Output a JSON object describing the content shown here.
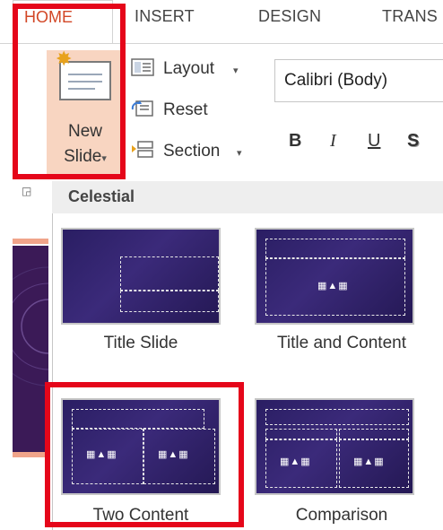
{
  "tabs": [
    {
      "label": "HOME",
      "active": true
    },
    {
      "label": "INSERT"
    },
    {
      "label": "DESIGN"
    },
    {
      "label": "TRANS"
    }
  ],
  "ribbon": {
    "new_slide_line1": "New",
    "new_slide_line2": "Slide",
    "new_slide_caret": "▾",
    "layout_label": "Layout",
    "reset_label": "Reset",
    "section_label": "Section",
    "caret": "▾",
    "font_name": "Calibri (Body)",
    "bold": "B",
    "italic": "I",
    "underline": "U",
    "shadow": "S"
  },
  "gallery": {
    "header": "Celestial",
    "layouts": [
      {
        "label": "Title Slide"
      },
      {
        "label": "Title and Content"
      },
      {
        "label": "Two Content"
      },
      {
        "label": "Comparison"
      }
    ]
  },
  "colors": {
    "accent": "#d24726",
    "highlight": "#e5061a",
    "new_slide_bg": "#f8d5c1",
    "theme_bg": "#2a1e63"
  }
}
